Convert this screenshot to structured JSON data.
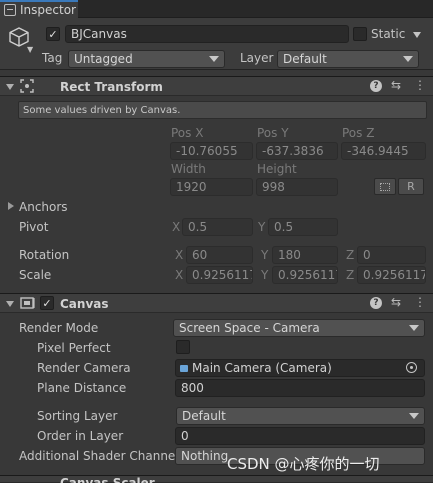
{
  "tab": {
    "label": "Inspector"
  },
  "object": {
    "name": "BJCanvas",
    "active": true,
    "static_label": "Static",
    "static_checked": false,
    "tag_label": "Tag",
    "tag_value": "Untagged",
    "layer_label": "Layer",
    "layer_value": "Default"
  },
  "rect_transform": {
    "title": "Rect Transform",
    "info": "Some values driven by Canvas.",
    "pos_x_label": "Pos X",
    "pos_y_label": "Pos Y",
    "pos_z_label": "Pos Z",
    "pos_x": "-10.76055",
    "pos_y": "-637.3836",
    "pos_z": "-346.9445",
    "width_label": "Width",
    "height_label": "Height",
    "width": "1920",
    "height": "998",
    "r_button": "R",
    "anchors_label": "Anchors",
    "pivot_label": "Pivot",
    "pivot_x_axis": "X",
    "pivot_x": "0.5",
    "pivot_y_axis": "Y",
    "pivot_y": "0.5",
    "rotation_label": "Rotation",
    "rot_x_axis": "X",
    "rot_x": "60",
    "rot_y_axis": "Y",
    "rot_y": "180",
    "rot_z_axis": "Z",
    "rot_z": "0",
    "scale_label": "Scale",
    "scale_x_axis": "X",
    "scale_x": "0.9256117",
    "scale_y_axis": "Y",
    "scale_y": "0.9256117",
    "scale_z_axis": "Z",
    "scale_z": "0.9256117"
  },
  "canvas": {
    "title": "Canvas",
    "enabled": true,
    "render_mode_label": "Render Mode",
    "render_mode": "Screen Space - Camera",
    "pixel_perfect_label": "Pixel Perfect",
    "pixel_perfect": false,
    "render_camera_label": "Render Camera",
    "render_camera": "Main Camera (Camera)",
    "plane_distance_label": "Plane Distance",
    "plane_distance": "800",
    "sorting_layer_label": "Sorting Layer",
    "sorting_layer": "Default",
    "order_in_layer_label": "Order in Layer",
    "order_in_layer": "0",
    "shader_channels_label": "Additional Shader Channels",
    "shader_channels": "Nothing"
  },
  "canvas_scaler": {
    "title": "Canvas Scaler"
  },
  "watermark": "CSDN @心疼你的一切",
  "colors": {
    "accent": "#3a79bb",
    "panel": "#383838",
    "field": "#2a2a2a"
  },
  "icons": [
    "inspector-icon",
    "gameobject-cube-icon",
    "rect-transform-icon",
    "canvas-icon",
    "camera-icon",
    "help-icon",
    "settings-icon",
    "more-icon",
    "object-picker-icon"
  ]
}
